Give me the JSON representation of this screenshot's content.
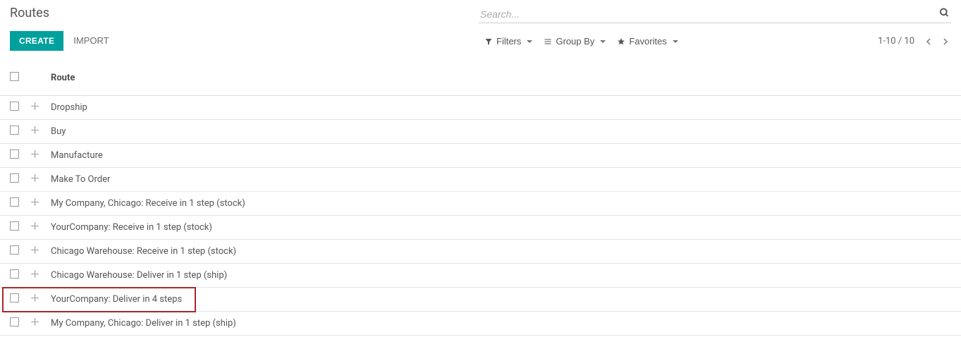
{
  "page": {
    "title": "Routes"
  },
  "toolbar": {
    "create_label": "CREATE",
    "import_label": "IMPORT",
    "filters_label": "Filters",
    "groupby_label": "Group By",
    "favorites_label": "Favorites"
  },
  "search": {
    "placeholder": "Search..."
  },
  "pager": {
    "text": "1-10 / 10"
  },
  "table": {
    "header_route": "Route",
    "rows": [
      {
        "label": "Dropship",
        "highlight": false
      },
      {
        "label": "Buy",
        "highlight": false
      },
      {
        "label": "Manufacture",
        "highlight": false
      },
      {
        "label": "Make To Order",
        "highlight": false
      },
      {
        "label": "My Company, Chicago: Receive in 1 step (stock)",
        "highlight": false
      },
      {
        "label": "YourCompany: Receive in 1 step (stock)",
        "highlight": false
      },
      {
        "label": "Chicago Warehouse: Receive in 1 step (stock)",
        "highlight": false
      },
      {
        "label": "Chicago Warehouse: Deliver in 1 step (ship)",
        "highlight": false
      },
      {
        "label": "YourCompany: Deliver in 4 steps",
        "highlight": true
      },
      {
        "label": "My Company, Chicago: Deliver in 1 step (ship)",
        "highlight": false
      }
    ]
  }
}
